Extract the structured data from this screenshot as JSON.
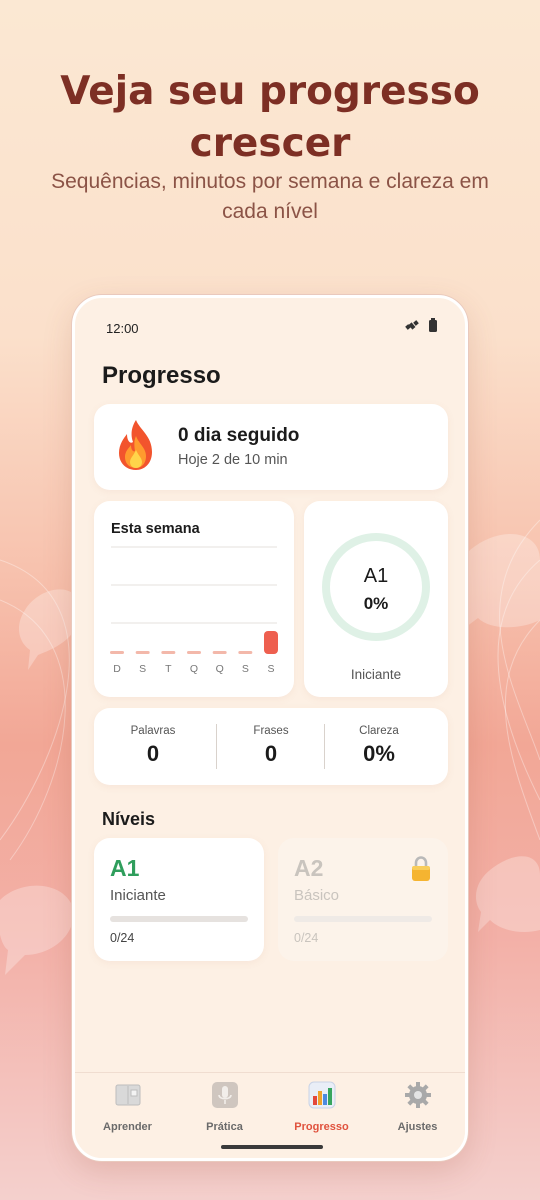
{
  "headline": "Veja seu progresso crescer",
  "subline": "Sequências, minutos por semana e clareza em cada nível",
  "status": {
    "time": "12:00"
  },
  "screen": {
    "title": "Progresso",
    "streak": {
      "icon": "fire-icon",
      "main": "0 dia seguido",
      "sub": "Hoje 2 de 10 min"
    },
    "week": {
      "title": "Esta semana",
      "chart_data": {
        "type": "bar",
        "categories": [
          "D",
          "S",
          "T",
          "Q",
          "Q",
          "S",
          "S"
        ],
        "values": [
          0,
          0,
          0,
          0,
          0,
          0,
          2
        ],
        "colors": {
          "empty": "#f3b8aa",
          "active": "#ee5f4f",
          "grid": "#e4e0dc"
        }
      }
    },
    "level_ring": {
      "level": "A1",
      "percent": "0%",
      "progress": 0,
      "name": "Iniciante",
      "ring_color": "#dff1e6"
    },
    "stats": [
      {
        "label": "Palavras",
        "value": "0"
      },
      {
        "label": "Frases",
        "value": "0"
      },
      {
        "label": "Clareza",
        "value": "0%"
      }
    ],
    "levels_title": "Níveis",
    "levels": [
      {
        "code": "A1",
        "name": "Iniciante",
        "count": "0/24",
        "progress": 0,
        "locked": false,
        "color": "#2f9e5c"
      },
      {
        "code": "A2",
        "name": "Básico",
        "count": "0/24",
        "progress": 0,
        "locked": true,
        "color": "#c9c4be"
      }
    ]
  },
  "nav": [
    {
      "label": "Aprender",
      "icon": "book-icon",
      "active": false
    },
    {
      "label": "Prática",
      "icon": "microphone-icon",
      "active": false
    },
    {
      "label": "Progresso",
      "icon": "bar-chart-icon",
      "active": true
    },
    {
      "label": "Ajustes",
      "icon": "gear-icon",
      "active": false
    }
  ]
}
